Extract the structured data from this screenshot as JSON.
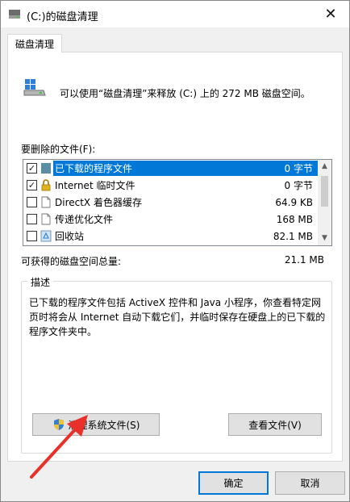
{
  "window": {
    "title": "(C:)的磁盘清理",
    "close_glyph": "✕"
  },
  "tabs": [
    {
      "label": "磁盘清理"
    }
  ],
  "header": {
    "text": "可以使用“磁盘清理”来释放  (C:) 上的 272 MB 磁盘空间。"
  },
  "files_section": {
    "label": "要删除的文件(F):",
    "items": [
      {
        "name": "已下载的程序文件",
        "size": "0 字节",
        "checked": true,
        "selected": true,
        "icon": "folder-icon"
      },
      {
        "name": "Internet 临时文件",
        "size": "0 字节",
        "checked": true,
        "selected": false,
        "icon": "lock-icon"
      },
      {
        "name": "DirectX 着色器缓存",
        "size": "64.9 KB",
        "checked": false,
        "selected": false,
        "icon": "document-icon"
      },
      {
        "name": "传递优化文件",
        "size": "168 MB",
        "checked": false,
        "selected": false,
        "icon": "document-icon"
      },
      {
        "name": "回收站",
        "size": "82.1 MB",
        "checked": false,
        "selected": false,
        "icon": "recycle-bin-icon"
      }
    ]
  },
  "total": {
    "label": "可获得的磁盘空间总量:",
    "value": "21.1 MB"
  },
  "description": {
    "label": "描述",
    "text": "已下载的程序文件包括 ActiveX 控件和 Java 小程序，你查看特定网页时将会从 Internet 自动下载它们，并临时保存在硬盘上的已下载的程序文件夹中。"
  },
  "buttons": {
    "cleanup_system": "清理系统文件(S)",
    "view_files": "查看文件(V)",
    "ok": "确定",
    "cancel": "取消"
  },
  "colors": {
    "selection": "#0078d7",
    "annotation_arrow": "#e8312a"
  }
}
